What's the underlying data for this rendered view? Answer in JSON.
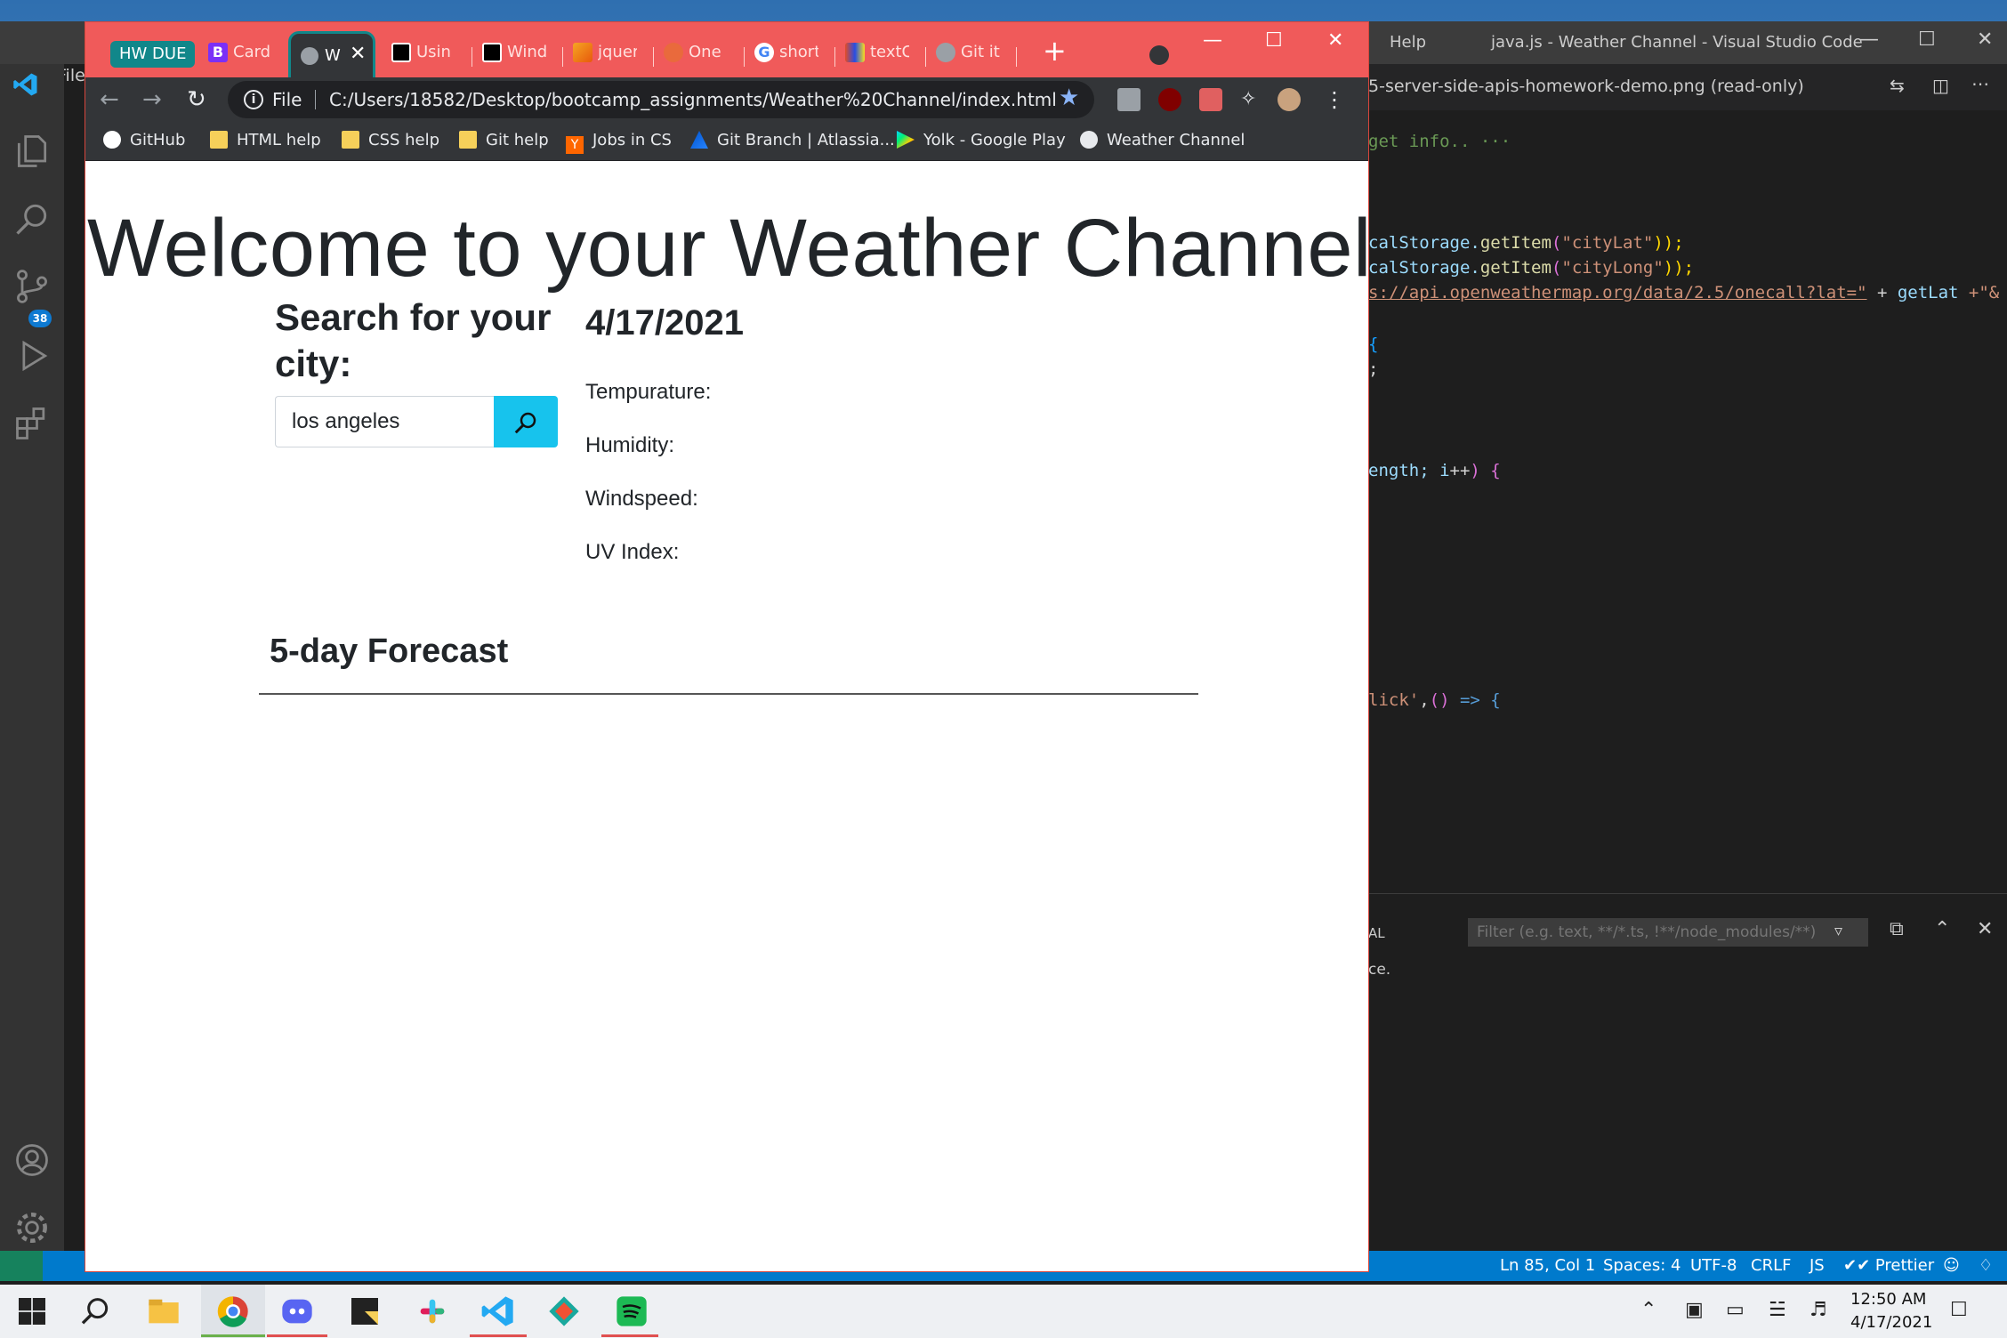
{
  "vscode": {
    "title": "java.js - Weather Channel - Visual Studio Code",
    "menu_help": "Help",
    "menu_file": "File",
    "scm_badge": "38",
    "tab_readonly": "5-server-side-apis-homework-demo.png (read-only)",
    "code": {
      "line0": "get info..",
      "line0_ellipsis": "···",
      "line1a": "calStorage.",
      "line1b": "getItem",
      "line1c": "(",
      "line1d": "\"cityLat\"",
      "line1e": "));",
      "line2a": "calStorage.",
      "line2b": "getItem",
      "line2c": "(",
      "line2d": "\"cityLong\"",
      "line2e": "));",
      "line3a": "s://api.openweathermap.org/data/2.5/onecall?lat=\"",
      "line3b": " + ",
      "line3c": "getLat",
      "line3d": " +\"&",
      "line4": "{",
      "line5": ";",
      "line6a": "ength; ",
      "line6b": "i",
      "line6c": "++",
      "line6d": ") {",
      "line7a": "lick'",
      "line7b": ",",
      "line7c": "()",
      "line7d": " => {"
    },
    "panel_tab": "AL",
    "filter_placeholder": "Filter (e.g. text, **/*.ts, !**/node_modules/**)",
    "panel_text": "ce.",
    "status": {
      "ln_col": "Ln 85, Col 1",
      "spaces": "Spaces: 4",
      "encoding": "UTF-8",
      "eol": "CRLF",
      "language": "JS",
      "prettier": "✔✔ Prettier"
    }
  },
  "chrome": {
    "group_chip": "HW DUE",
    "tabs": [
      {
        "label": "Card"
      },
      {
        "label": "Usin"
      },
      {
        "label": "Wind"
      },
      {
        "label": "jquer"
      },
      {
        "label": "One"
      },
      {
        "label": "short"
      },
      {
        "label": "textC"
      },
      {
        "label": "Git it"
      }
    ],
    "active_tab": "W",
    "scheme": "File",
    "url": "C:/Users/18582/Desktop/bootcamp_assignments/Weather%20Channel/index.html",
    "bookmarks": [
      {
        "label": "GitHub"
      },
      {
        "label": "HTML help"
      },
      {
        "label": "CSS help"
      },
      {
        "label": "Git help"
      },
      {
        "label": "Jobs in CS"
      },
      {
        "label": "Git Branch | Atlassia..."
      },
      {
        "label": "Yolk - Google Play"
      },
      {
        "label": "Weather Channel"
      }
    ]
  },
  "page": {
    "title": "Welcome to your Weather Channel",
    "search_heading": "Search for your city:",
    "search_value": "los angeles",
    "date": "4/17/2021",
    "temperature_label": "Tempurature:",
    "humidity_label": "Humidity:",
    "windspeed_label": "Windspeed:",
    "uv_label": "UV Index:",
    "forecast_heading": "5-day Forecast"
  },
  "taskbar": {
    "time": "12:50 AM",
    "date": "4/17/2021"
  },
  "colors": {
    "chrome_tabstrip": "#f05a5a",
    "group_chip": "#11878a",
    "search_button": "#17c3ed",
    "vscode_statusbar": "#007acc"
  }
}
